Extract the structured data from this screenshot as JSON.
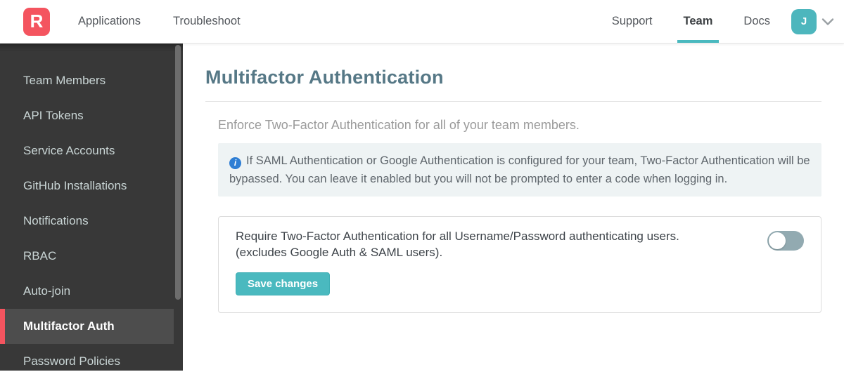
{
  "brand": {
    "logo_letter": "R"
  },
  "header": {
    "nav_left": [
      {
        "label": "Applications"
      },
      {
        "label": "Troubleshoot"
      }
    ],
    "nav_right": [
      {
        "label": "Support"
      },
      {
        "label": "Team",
        "active": true
      },
      {
        "label": "Docs"
      }
    ],
    "avatar_initial": "J"
  },
  "sidebar": {
    "items": [
      {
        "label": "Team Members"
      },
      {
        "label": "API Tokens"
      },
      {
        "label": "Service Accounts"
      },
      {
        "label": "GitHub Installations"
      },
      {
        "label": "Notifications"
      },
      {
        "label": "RBAC"
      },
      {
        "label": "Auto-join"
      },
      {
        "label": "Multifactor Auth",
        "active": true
      },
      {
        "label": "Password Policies"
      }
    ]
  },
  "main": {
    "title": "Multifactor Authentication",
    "intro": "Enforce Two-Factor Authentication for all of your team members.",
    "info_note": {
      "icon": "info-icon",
      "text": "If SAML Authentication or Google Authentication is configured for your team, Two-Factor Authentication will be bypassed. You can leave it enabled but you will not be prompted to enter a code when logging in."
    },
    "card": {
      "description_line1": "Require Two-Factor Authentication for all Username/Password authenticating users.",
      "description_line2": "(excludes Google Auth & SAML users).",
      "toggle_state": "off",
      "save_label": "Save changes"
    }
  },
  "colors": {
    "brand_red": "#f4545f",
    "accent_teal": "#4ab9bf",
    "avatar_teal": "#4db6bd",
    "heading_slate": "#567886",
    "sidebar_bg": "#383838",
    "sidebar_active_bg": "#4d4d4d",
    "info_bg": "#eef3f4",
    "info_icon_blue": "#2e7ed4",
    "toggle_off": "#92aab1"
  }
}
